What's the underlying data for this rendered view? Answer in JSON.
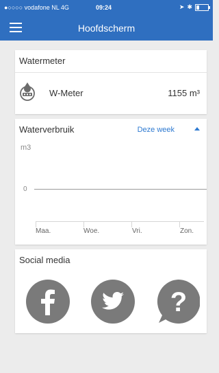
{
  "status_bar": {
    "carrier": "●○○○○ vodafone NL  4G",
    "time": "09:24",
    "bluetooth": "✱",
    "location": "➤",
    "battery_level": 0.25
  },
  "header": {
    "title": "Hoofdscherm",
    "menu_icon": "hamburger-icon"
  },
  "watermeter": {
    "title": "Watermeter",
    "item_name": "W-Meter",
    "item_value": "1155 m³",
    "icon": "water-meter-icon"
  },
  "waterverbruik": {
    "title": "Waterverbruik",
    "period": "Deze week",
    "unit": "m3",
    "zero_label": "0",
    "days": [
      "Maa.",
      "Woe.",
      "Vri.",
      "Zon."
    ]
  },
  "social": {
    "title": "Social media",
    "icons": [
      "facebook-icon",
      "twitter-icon",
      "help-icon"
    ]
  },
  "colors": {
    "header_bg": "#2f6fc0",
    "accent": "#2e7ad1",
    "icon_gray": "#7a7a7a"
  }
}
